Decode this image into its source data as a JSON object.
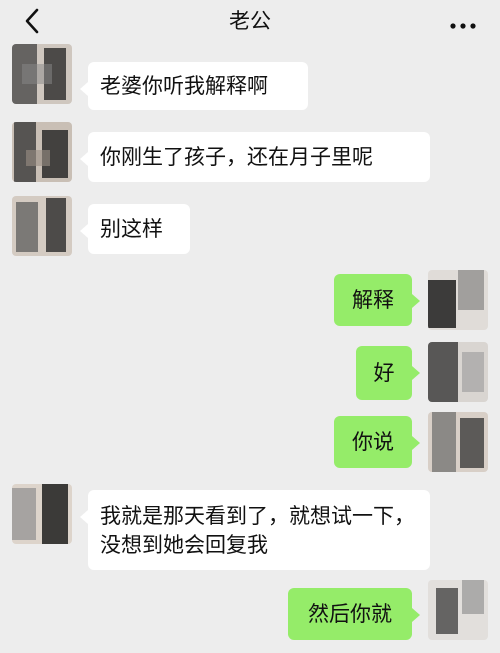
{
  "header": {
    "title": "老公",
    "back_icon": "chevron-left-icon",
    "more_icon": "more-dots-icon"
  },
  "messages": [
    {
      "side": "incoming",
      "text": "老婆你听我解释啊"
    },
    {
      "side": "incoming",
      "text": "你刚生了孩子，还在月子里呢"
    },
    {
      "side": "incoming",
      "text": "别这样"
    },
    {
      "side": "outgoing",
      "text": "解释"
    },
    {
      "side": "outgoing",
      "text": "好"
    },
    {
      "side": "outgoing",
      "text": "你说"
    },
    {
      "side": "incoming",
      "text": "我就是那天看到了，就想试一下，没想到她会回复我"
    },
    {
      "side": "outgoing",
      "text": "然后你就"
    }
  ],
  "colors": {
    "background": "#ededed",
    "incoming_bubble": "#ffffff",
    "outgoing_bubble": "#95ec69"
  }
}
